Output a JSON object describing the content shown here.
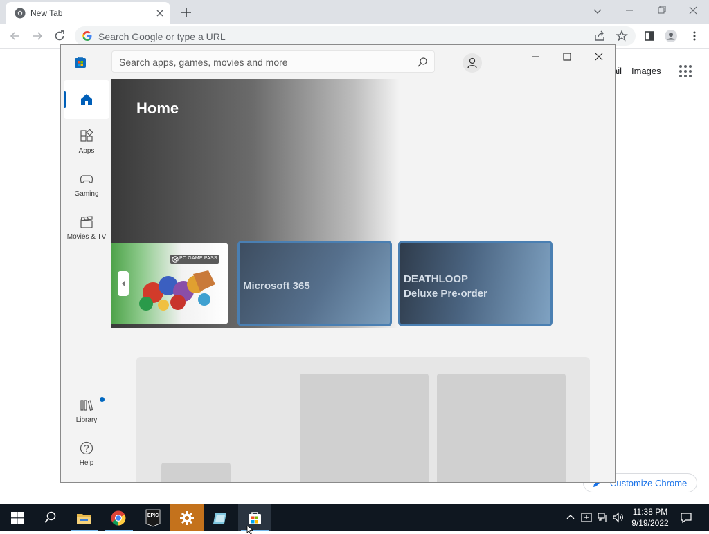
{
  "browser": {
    "tab_title": "New Tab",
    "omnibox_placeholder": "Search Google or type a URL",
    "ntp_links": {
      "gmail_partial": "ail",
      "images": "Images"
    },
    "customize_label": "Customize Chrome"
  },
  "store": {
    "search_placeholder": "Search apps, games, movies and more",
    "nav": [
      {
        "label": "",
        "icon": "home-icon"
      },
      {
        "label": "Apps",
        "icon": "apps-icon"
      },
      {
        "label": "Gaming",
        "icon": "gamepad-icon"
      },
      {
        "label": "Movies & TV",
        "icon": "clapperboard-icon"
      }
    ],
    "nav_bottom": [
      {
        "label": "Library",
        "icon": "library-icon"
      },
      {
        "label": "Help",
        "icon": "help-icon"
      }
    ],
    "page_title": "Home",
    "cards": {
      "pass_badge": "PC GAME PASS",
      "ms365": "Microsoft 365",
      "deathloop_line1": "DEATHLOOP",
      "deathloop_line2": "Deluxe Pre-order"
    },
    "colors": {
      "accent": "#005fb8",
      "card_border": "#4a7fb2",
      "notification_dot": "#0067c0"
    }
  },
  "taskbar": {
    "time": "11:38 PM",
    "date": "9/19/2022",
    "epic_label": "EPIC"
  }
}
